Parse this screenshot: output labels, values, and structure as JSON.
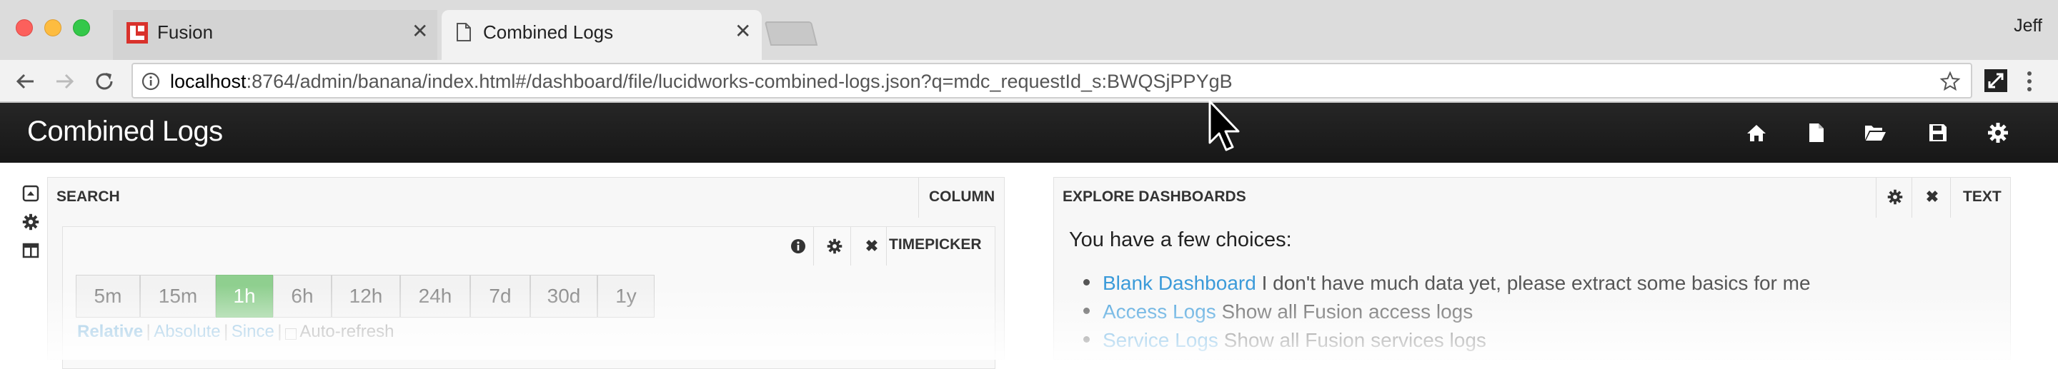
{
  "browser": {
    "tabs": [
      {
        "label": "Fusion",
        "active": false
      },
      {
        "label": "Combined Logs",
        "active": true
      }
    ],
    "profile": "Jeff",
    "url_host": "localhost",
    "url_rest": ":8764/admin/banana/index.html#/dashboard/file/lucidworks-combined-logs.json?q=mdc_requestId_s:BWQSjPPYgB"
  },
  "app": {
    "title": "Combined Logs",
    "nav_icons": [
      "home-icon",
      "new-file-icon",
      "open-folder-icon",
      "save-icon",
      "gear-icon"
    ]
  },
  "sidebar": {
    "icons": [
      "collapse-up-icon",
      "gear-icon",
      "columns-icon"
    ]
  },
  "search_panel": {
    "title": "SEARCH",
    "type": "COLUMN",
    "timepicker": {
      "type": "TIMEPICKER",
      "ranges": [
        "5m",
        "15m",
        "1h",
        "6h",
        "12h",
        "24h",
        "7d",
        "30d",
        "1y"
      ],
      "selected": "1h",
      "modes": [
        "Relative",
        "Absolute",
        "Since"
      ],
      "auto_refresh": "Auto-refresh"
    }
  },
  "explore_panel": {
    "title": "EXPLORE DASHBOARDS",
    "type": "TEXT",
    "intro": "You have a few choices:",
    "items": [
      {
        "link": "Blank Dashboard",
        "text": " I don't have much data yet, please extract some basics for me"
      },
      {
        "link": "Access Logs",
        "text": " Show all Fusion access logs"
      },
      {
        "link": "Service Logs",
        "text": " Show all Fusion services logs"
      }
    ]
  },
  "colors": {
    "navbar": "#1c1c1c",
    "active_range": "#8fcf8f",
    "link": "#3a9ad9",
    "fusion_logo": "#d9312b"
  }
}
